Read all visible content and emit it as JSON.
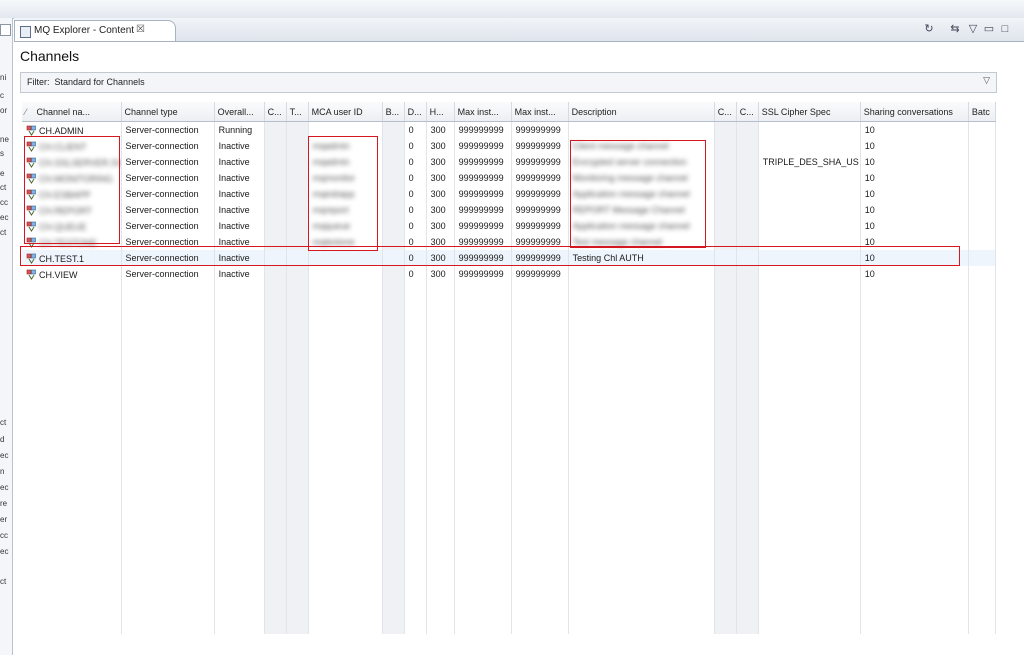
{
  "window": {
    "tab_title": "MQ Explorer - Content",
    "tab_close": "☒",
    "toolbar": [
      {
        "name": "refresh-icon",
        "glyph": "↻"
      },
      {
        "name": "collapse-icon",
        "glyph": "⇆"
      },
      {
        "name": "view-menu-icon",
        "glyph": "▽"
      },
      {
        "name": "minimize-icon",
        "glyph": "▭"
      },
      {
        "name": "maximize-icon",
        "glyph": "□"
      }
    ]
  },
  "page_title": "Channels",
  "filter": {
    "label": "Filter:",
    "value": "Standard for Channels"
  },
  "left_panel_fragments": [
    "ni",
    "c",
    "or",
    "ne",
    "s",
    "e",
    "ct",
    "cc",
    "ec",
    "ct",
    "ct",
    "d",
    "ec",
    "n",
    "ec",
    "re",
    "er",
    "cc",
    "ec",
    "ct"
  ],
  "columns": [
    "Channel na...",
    "Channel type",
    "Overall...",
    "C...",
    "T...",
    "MCA user ID",
    "B...",
    "D...",
    "H...",
    "Max inst...",
    "Max inst...",
    "Description",
    "C...",
    "C...",
    "SSL Cipher Spec",
    "Sharing conversations",
    "Batc"
  ],
  "rows": [
    {
      "name": "CH.ADMIN",
      "type": "Server-connection",
      "status": "Running",
      "mca": "",
      "d": "0",
      "h": "300",
      "max1": "999999999",
      "max2": "999999999",
      "desc": "",
      "ssl": "",
      "share": "10",
      "blur": false
    },
    {
      "name": "CH.CLIENT",
      "type": "Server-connection",
      "status": "Inactive",
      "mca": "mqadmin",
      "d": "0",
      "h": "300",
      "max1": "999999999",
      "max2": "999999999",
      "desc": "Client message channel",
      "ssl": "",
      "share": "10",
      "blur": true
    },
    {
      "name": "CH.SSLSERVER.SVRCONN",
      "type": "Server-connection",
      "status": "Inactive",
      "mca": "mqadmin",
      "d": "0",
      "h": "300",
      "max1": "999999999",
      "max2": "999999999",
      "desc": "Encrypted server connection",
      "ssl": "TRIPLE_DES_SHA_US",
      "share": "10",
      "blur": true
    },
    {
      "name": "CH.MONITORING",
      "type": "Server-connection",
      "status": "Inactive",
      "mca": "mqmonitor",
      "d": "0",
      "h": "300",
      "max1": "999999999",
      "max2": "999999999",
      "desc": "Monitoring message channel",
      "ssl": "",
      "share": "10",
      "blur": true
    },
    {
      "name": "CH.ESBAPP",
      "type": "Server-connection",
      "status": "Inactive",
      "mca": "mqesbapp",
      "d": "0",
      "h": "300",
      "max1": "999999999",
      "max2": "999999999",
      "desc": "Application message channel",
      "ssl": "",
      "share": "10",
      "blur": true
    },
    {
      "name": "CH.REPORT",
      "type": "Server-connection",
      "status": "Inactive",
      "mca": "mqreport",
      "d": "0",
      "h": "300",
      "max1": "999999999",
      "max2": "999999999",
      "desc": "REPORT Message Channel",
      "ssl": "",
      "share": "10",
      "blur": true
    },
    {
      "name": "CH.QUEUE",
      "type": "Server-connection",
      "status": "Inactive",
      "mca": "mqqueue",
      "d": "0",
      "h": "300",
      "max1": "999999999",
      "max2": "999999999",
      "desc": "Application message channel",
      "ssl": "",
      "share": "10",
      "blur": true
    },
    {
      "name": "CH.TESTONE",
      "type": "Server-connection",
      "status": "Inactive",
      "mca": "mqtestone",
      "d": "0",
      "h": "300",
      "max1": "999999999",
      "max2": "999999999",
      "desc": "Test message channel",
      "ssl": "",
      "share": "10",
      "blur": true
    },
    {
      "name": "CH.TEST.1",
      "type": "Server-connection",
      "status": "Inactive",
      "mca": "",
      "d": "0",
      "h": "300",
      "max1": "999999999",
      "max2": "999999999",
      "desc": "Testing Chl AUTH",
      "ssl": "",
      "share": "10",
      "blur": false
    },
    {
      "name": "CH.VIEW",
      "type": "Server-connection",
      "status": "Inactive",
      "mca": "",
      "d": "0",
      "h": "300",
      "max1": "999999999",
      "max2": "999999999",
      "desc": "",
      "ssl": "",
      "share": "10",
      "blur": false
    }
  ],
  "colors": {
    "highlight_box": "#d4181f",
    "header_bg": "#eceff3",
    "selected_row_bg": "#eef5fc"
  }
}
